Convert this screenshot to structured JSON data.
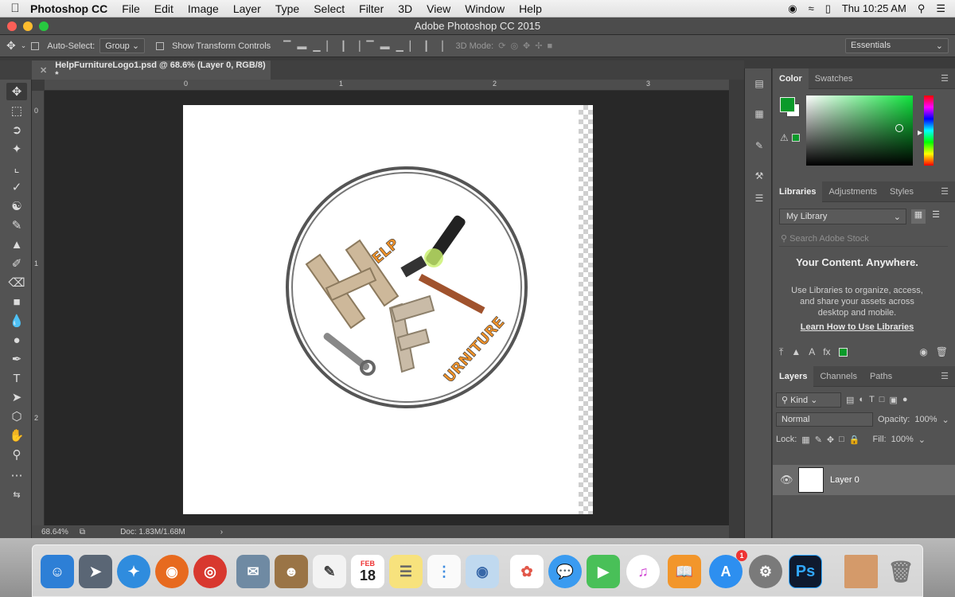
{
  "menubar": {
    "app_name": "Photoshop CC",
    "items": [
      "File",
      "Edit",
      "Image",
      "Layer",
      "Type",
      "Select",
      "Filter",
      "3D",
      "View",
      "Window",
      "Help"
    ],
    "clock": "Thu 10:25 AM"
  },
  "window": {
    "title": "Adobe Photoshop CC 2015"
  },
  "options_bar": {
    "auto_select_label": "Auto-Select:",
    "auto_select_value": "Group",
    "transform_label": "Show Transform Controls",
    "mode_3d_label": "3D Mode:",
    "workspace": "Essentials"
  },
  "document": {
    "tab_title": "HelpFurnitureLogo1.psd @ 68.6% (Layer 0, RGB/8) *",
    "ruler_top": [
      "0",
      "1",
      "2",
      "3"
    ],
    "ruler_left": [
      "0",
      "1",
      "2"
    ],
    "zoom": "68.64%",
    "doc_info": "Doc: 1.83M/1.68M",
    "logo_text_top": "ELP",
    "logo_text_bottom": "URNITURE"
  },
  "color_panel": {
    "tabs": [
      "Color",
      "Swatches"
    ],
    "foreground": "#0a9a2a",
    "background": "#ffffff"
  },
  "libraries_panel": {
    "tabs": [
      "Libraries",
      "Adjustments",
      "Styles"
    ],
    "library": "My Library",
    "search_placeholder": "Search Adobe Stock",
    "heading": "Your Content. Anywhere.",
    "description": "Use Libraries to organize, access, and share your assets across desktop and mobile.",
    "link": "Learn How to Use Libraries"
  },
  "layers_panel": {
    "tabs": [
      "Layers",
      "Channels",
      "Paths"
    ],
    "filter": "Kind",
    "blend_mode": "Normal",
    "opacity_label": "Opacity:",
    "opacity": "100%",
    "lock_label": "Lock:",
    "fill_label": "Fill:",
    "fill": "100%",
    "layers": [
      {
        "name": "Layer 0"
      }
    ]
  },
  "dock": {
    "calendar_month": "FEB",
    "calendar_day": "18",
    "appstore_badge": "1",
    "photoshop_label": "Ps"
  }
}
